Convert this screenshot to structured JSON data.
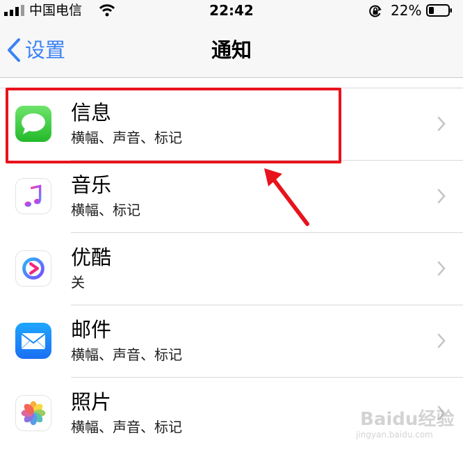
{
  "status_bar": {
    "carrier": "中国电信",
    "time": "22:42",
    "battery_percent": "22%"
  },
  "nav": {
    "back_label": "设置",
    "title": "通知"
  },
  "apps": [
    {
      "name": "信息",
      "subtitle": "横幅、声音、标记",
      "icon": "messages-icon"
    },
    {
      "name": "音乐",
      "subtitle": "横幅、标记",
      "icon": "music-icon"
    },
    {
      "name": "优酷",
      "subtitle": "关",
      "icon": "youku-icon"
    },
    {
      "name": "邮件",
      "subtitle": "横幅、声音、标记",
      "icon": "mail-icon"
    },
    {
      "name": "照片",
      "subtitle": "横幅、声音、标记",
      "icon": "photos-icon"
    }
  ],
  "watermark": {
    "logo_text": "Baidu经验",
    "url": "jingyan.baidu.com"
  },
  "colors": {
    "accent": "#3b82f6",
    "highlight": "#e8131c"
  }
}
